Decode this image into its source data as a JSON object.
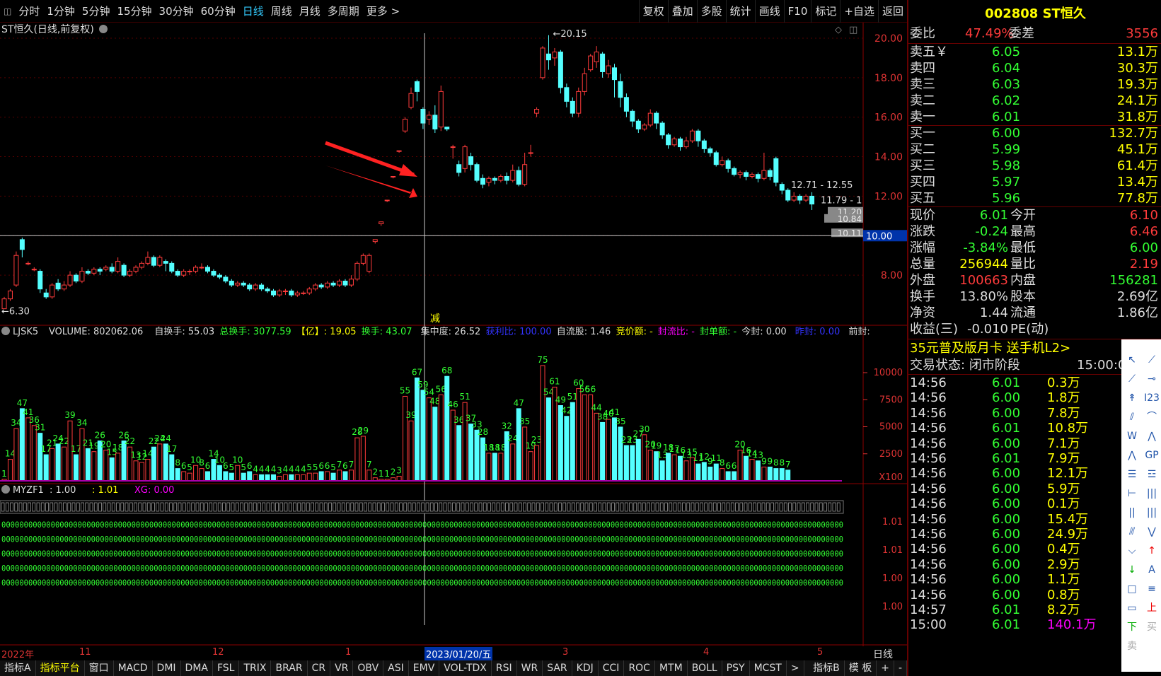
{
  "periods": [
    "分时",
    "1分钟",
    "5分钟",
    "15分钟",
    "30分钟",
    "60分钟",
    "日线",
    "周线",
    "月线",
    "多周期",
    "更多 >"
  ],
  "active_period": "日线",
  "tools": [
    "复权",
    "叠加",
    "多股",
    "统计",
    "画线",
    "F10",
    "标记",
    "+自选",
    "返回"
  ],
  "chart_title": "ST恒久(日线,前复权)",
  "price_axis": [
    "20.00",
    "18.00",
    "16.00",
    "14.00",
    "12.00",
    "10.00",
    "8.00"
  ],
  "price_cross": "10.00",
  "annotations": {
    "high": "20.15",
    "low": "6.30",
    "range1": "12.71 - 12.55",
    "range2": "11.79 - 1",
    "bar1": "11.20",
    "bar2": "10.84",
    "bar3": "10.11",
    "jian": "减"
  },
  "vol_header": [
    {
      "t": "LJSK5",
      "c": "#ddd"
    },
    {
      "t": "VOLUME: 802062.06",
      "c": "#ddd"
    },
    {
      "t": "自换手: 55.03",
      "c": "#ddd"
    },
    {
      "t": "总换手: 3077.59",
      "c": "#3f3"
    },
    {
      "t": "【亿】: 19.05",
      "c": "#ff0"
    },
    {
      "t": "换手: 43.07",
      "c": "#3f3"
    },
    {
      "t": "集中度: 26.52",
      "c": "#ddd"
    },
    {
      "t": "获利比: 100.00",
      "c": "#33f"
    },
    {
      "t": "自流股: 1.46",
      "c": "#ddd"
    },
    {
      "t": "竞价额: -",
      "c": "#ff0"
    },
    {
      "t": "封流比: -",
      "c": "#f0f"
    },
    {
      "t": "封单额: -",
      "c": "#3f3"
    },
    {
      "t": "今封: 0.00",
      "c": "#ddd"
    },
    {
      "t": "昨封: 0.00",
      "c": "#33f"
    },
    {
      "t": "前封:",
      "c": "#ddd"
    }
  ],
  "vol_axis": [
    "10000",
    "7500",
    "5000",
    "2500",
    "X100"
  ],
  "ind_header": [
    {
      "t": "MYZF1",
      "c": "#ddd"
    },
    {
      "t": ": 1.00",
      "c": "#ddd"
    },
    {
      "t": ": 1.01",
      "c": "#ff0"
    },
    {
      "t": "XG: 0.00",
      "c": "#f0f"
    }
  ],
  "ind_axis": [
    "1.01",
    "1.01",
    "1.00",
    "1.00"
  ],
  "bin_rows": [
    "00000000000000000000000000000000000000000000000000000000000000000000000000000000000000000000000000000000000000000000000000000000000000000000000000000000000000000000000000000000000000000000",
    "00000000000000000000000000000000000000000000000000000000000000000000000000000000000000000000000000000000000000000000000000000000000000000000000000000000000000000000000000000000000000000000",
    "00000000000000000000000000000000000000000000000000000000000000000000000000000000000000000000000000000000000000000000000000000000000000000000000000000000000000000000000000000000000000000000",
    "00000000000000000000000000000000000000000000000000000000000000000000000000000000000000000000000000000000000000000000000000000000000000000000000000000000000000000000000000000000000000000000",
    "00000000000000000000000000000000000000000000000000000000000000000000000000000000000000000000000000000000000000000000000000000000000000000000000000000000000000000000000000000000000000000000"
  ],
  "date_axis": [
    "2022年",
    "11",
    "12",
    "1",
    "2023/01/20/五",
    "3",
    "4",
    "5"
  ],
  "bottom_tabs": [
    "指标A",
    "指标平台",
    "窗口",
    "MACD",
    "DMI",
    "DMA",
    "FSL",
    "TRIX",
    "BRAR",
    "CR",
    "VR",
    "OBV",
    "ASI",
    "EMV",
    "VOL-TDX",
    "RSI",
    "WR",
    "SAR",
    "KDJ",
    "CCI",
    "ROC",
    "MTM",
    "BOLL",
    "PSY",
    "MCST",
    ">",
    "指标B",
    "模 板",
    "+",
    "-"
  ],
  "bottom_right": "日线",
  "quote": {
    "code": "002808 ST恒久",
    "weibi_label": "委比",
    "weibi": "47.49%",
    "weicha_label": "委差",
    "weicha": "3556",
    "asks": [
      [
        "卖五￥",
        "6.05",
        "13.1万"
      ],
      [
        "卖四",
        "6.04",
        "30.3万"
      ],
      [
        "卖三",
        "6.03",
        "19.3万"
      ],
      [
        "卖二",
        "6.02",
        "24.1万"
      ],
      [
        "卖一",
        "6.01",
        "31.8万"
      ]
    ],
    "bids": [
      [
        "买一",
        "6.00",
        "132.7万"
      ],
      [
        "买二",
        "5.99",
        "45.1万"
      ],
      [
        "买三",
        "5.98",
        "61.4万"
      ],
      [
        "买四",
        "5.97",
        "13.4万"
      ],
      [
        "买五",
        "5.96",
        "77.8万"
      ]
    ],
    "stats": [
      [
        "现价",
        "6.01",
        "今开",
        "6.10"
      ],
      [
        "涨跌",
        "-0.24",
        "最高",
        "6.46"
      ],
      [
        "涨幅",
        "-3.84%",
        "最低",
        "6.00"
      ],
      [
        "总量",
        "256944",
        "量比",
        "2.19"
      ],
      [
        "外盘",
        "100663",
        "内盘",
        "156281"
      ],
      [
        "换手",
        "13.80%",
        "股本",
        "2.69亿"
      ],
      [
        "净资",
        "1.44",
        "流通",
        "1.86亿"
      ],
      [
        "收益(三)",
        "-0.010",
        "PE(动)",
        ""
      ]
    ],
    "ad": "35元普及版月卡 送手机L2>",
    "status": "交易状态: 闭市阶段",
    "status_time": "15:00:00",
    "ticks": [
      [
        "14:56",
        "6.01",
        "0.3万"
      ],
      [
        "14:56",
        "6.00",
        "1.8万"
      ],
      [
        "14:56",
        "6.00",
        "7.8万"
      ],
      [
        "14:56",
        "6.01",
        "10.8万"
      ],
      [
        "14:56",
        "6.00",
        "7.1万"
      ],
      [
        "14:56",
        "6.01",
        "7.9万"
      ],
      [
        "14:56",
        "6.00",
        "12.1万"
      ],
      [
        "14:56",
        "6.00",
        "5.9万"
      ],
      [
        "14:56",
        "6.00",
        "0.1万"
      ],
      [
        "14:56",
        "6.00",
        "15.4万"
      ],
      [
        "14:56",
        "6.00",
        "24.9万"
      ],
      [
        "14:56",
        "6.00",
        "0.4万"
      ],
      [
        "14:56",
        "6.00",
        "2.9万"
      ],
      [
        "14:56",
        "6.00",
        "1.1万"
      ],
      [
        "14:56",
        "6.00",
        "0.8万"
      ],
      [
        "14:57",
        "6.01",
        "8.2万"
      ],
      [
        "15:00",
        "6.01",
        "140.1万"
      ]
    ]
  },
  "draw_tools": [
    "cursor",
    "line",
    "ray",
    "segment",
    "arrow",
    "i23",
    "parallel",
    "arc",
    "wave",
    "gann",
    "peak",
    "fib",
    "gp",
    "channel",
    "text",
    "hline",
    "vline",
    "bars",
    "bars2",
    "fan",
    "down",
    "arrow-up",
    "arrow-down",
    "text-a",
    "rect",
    "note",
    "ruler",
    "up-label",
    "down-label",
    "buy",
    "sell"
  ],
  "draw_labels": {
    "buy": "买",
    "sell": "卖",
    "up": "上",
    "down": "下"
  },
  "chart_data": {
    "type": "candlestick",
    "title": "ST恒久(日线,前复权)",
    "ylim": [
      6.0,
      20.5
    ],
    "candles": [
      [
        6.3,
        6.8,
        6.3,
        6.9
      ],
      [
        6.8,
        7.2,
        6.7,
        7.3
      ],
      [
        7.5,
        9.0,
        7.4,
        9.2
      ],
      [
        9.8,
        9.3,
        8.9,
        9.9
      ],
      [
        8.6,
        8.6,
        8.5,
        8.7
      ],
      [
        8.3,
        8.3,
        8.2,
        8.4
      ],
      [
        8.2,
        7.3,
        7.1,
        8.3
      ],
      [
        7.1,
        6.9,
        6.8,
        7.3
      ],
      [
        6.9,
        7.5,
        6.8,
        7.6
      ],
      [
        7.6,
        7.3,
        7.2,
        7.8
      ],
      [
        7.3,
        7.5,
        7.2,
        7.7
      ],
      [
        7.5,
        8.0,
        7.4,
        8.2
      ],
      [
        8.0,
        7.7,
        7.6,
        8.1
      ],
      [
        7.7,
        8.2,
        7.6,
        8.4
      ],
      [
        8.2,
        8.1,
        8.0,
        8.3
      ],
      [
        8.1,
        8.3,
        8.0,
        8.4
      ],
      [
        8.3,
        8.2,
        8.0,
        8.4
      ],
      [
        8.3,
        8.4,
        8.2,
        8.5
      ],
      [
        8.4,
        8.2,
        8.1,
        8.6
      ],
      [
        8.2,
        8.7,
        8.1,
        8.9
      ],
      [
        8.5,
        8.0,
        7.9,
        8.6
      ],
      [
        8.0,
        8.2,
        7.9,
        8.3
      ],
      [
        8.2,
        8.4,
        8.1,
        8.5
      ],
      [
        8.4,
        8.6,
        8.3,
        8.7
      ],
      [
        8.6,
        8.9,
        8.5,
        9.2
      ],
      [
        8.9,
        8.5,
        8.4,
        9.0
      ],
      [
        8.5,
        8.9,
        8.4,
        9.0
      ],
      [
        8.7,
        8.6,
        8.2,
        8.8
      ],
      [
        8.6,
        8.2,
        8.1,
        8.7
      ],
      [
        8.2,
        8.0,
        7.9,
        8.3
      ],
      [
        8.0,
        8.2,
        7.9,
        8.3
      ],
      [
        8.2,
        8.2,
        8.0,
        8.3
      ],
      [
        8.2,
        8.4,
        8.1,
        8.5
      ],
      [
        8.4,
        8.4,
        8.3,
        8.6
      ],
      [
        8.4,
        8.2,
        8.1,
        8.5
      ],
      [
        8.2,
        8.0,
        7.9,
        8.3
      ],
      [
        8.0,
        7.9,
        7.8,
        8.1
      ],
      [
        7.9,
        7.7,
        7.6,
        8.0
      ],
      [
        7.7,
        7.5,
        7.4,
        7.8
      ],
      [
        7.5,
        7.6,
        7.4,
        7.7
      ],
      [
        7.6,
        7.5,
        7.4,
        7.7
      ],
      [
        7.5,
        7.3,
        7.2,
        7.6
      ],
      [
        7.3,
        7.5,
        7.2,
        7.6
      ],
      [
        7.5,
        7.3,
        7.2,
        7.6
      ],
      [
        7.3,
        7.2,
        7.1,
        7.4
      ],
      [
        7.2,
        7.0,
        6.9,
        7.3
      ],
      [
        7.0,
        7.2,
        6.9,
        7.3
      ],
      [
        7.2,
        7.2,
        7.0,
        7.3
      ],
      [
        7.2,
        7.0,
        6.9,
        7.3
      ],
      [
        7.0,
        7.1,
        6.9,
        7.2
      ],
      [
        7.1,
        7.1,
        7.0,
        7.2
      ],
      [
        7.1,
        7.3,
        7.0,
        7.4
      ],
      [
        7.3,
        7.5,
        7.2,
        7.6
      ],
      [
        7.5,
        7.4,
        7.3,
        7.6
      ],
      [
        7.4,
        7.6,
        7.3,
        7.7
      ],
      [
        7.6,
        7.5,
        7.4,
        7.7
      ],
      [
        7.5,
        7.7,
        7.4,
        7.8
      ],
      [
        7.7,
        7.5,
        7.4,
        7.8
      ],
      [
        7.5,
        7.8,
        7.4,
        8.0
      ],
      [
        7.8,
        8.6,
        7.7,
        8.7
      ],
      [
        8.6,
        9.0,
        8.5,
        9.1
      ],
      [
        8.2,
        9.0,
        8.1,
        9.1
      ],
      [
        9.7,
        9.8,
        9.6,
        9.8
      ],
      [
        10.6,
        10.7,
        10.5,
        10.7
      ],
      [
        11.8,
        11.8,
        11.7,
        11.8
      ],
      [
        13.0,
        13.0,
        12.9,
        13.0
      ],
      [
        14.3,
        14.3,
        14.2,
        14.3
      ],
      [
        15.3,
        15.9,
        15.2,
        16.0
      ],
      [
        16.5,
        17.2,
        16.4,
        17.5
      ],
      [
        17.8,
        17.3,
        16.8,
        17.9
      ],
      [
        16.4,
        15.7,
        15.4,
        16.5
      ],
      [
        15.9,
        16.1,
        15.6,
        16.3
      ],
      [
        16.1,
        15.4,
        15.2,
        16.6
      ],
      [
        15.5,
        17.3,
        15.3,
        17.6
      ],
      [
        15.5,
        15.4,
        15.3,
        15.5
      ],
      [
        14.5,
        14.5,
        13.9,
        14.6
      ],
      [
        13.6,
        13.2,
        13.0,
        13.8
      ],
      [
        13.4,
        14.5,
        13.2,
        14.6
      ],
      [
        14.0,
        13.6,
        13.3,
        14.2
      ],
      [
        13.6,
        12.8,
        12.7,
        13.7
      ],
      [
        12.9,
        12.6,
        12.4,
        13.1
      ],
      [
        12.7,
        12.9,
        12.5,
        13.0
      ],
      [
        12.9,
        12.8,
        12.6,
        13.0
      ],
      [
        12.8,
        13.0,
        12.7,
        13.1
      ],
      [
        13.0,
        12.8,
        12.6,
        13.2
      ],
      [
        12.8,
        13.3,
        12.7,
        13.6
      ],
      [
        13.3,
        12.6,
        12.5,
        13.5
      ],
      [
        12.6,
        13.6,
        12.5,
        14.2
      ],
      [
        14.2,
        14.2,
        14.0,
        14.6
      ],
      [
        16.2,
        16.4,
        16.0,
        16.5
      ],
      [
        18.0,
        19.5,
        17.9,
        19.6
      ],
      [
        19.2,
        18.9,
        18.4,
        20.15
      ],
      [
        19.0,
        19.3,
        18.6,
        19.5
      ],
      [
        19.3,
        17.5,
        17.2,
        19.4
      ],
      [
        17.5,
        16.8,
        16.5,
        17.7
      ],
      [
        16.8,
        16.2,
        16.0,
        17.0
      ],
      [
        16.2,
        17.3,
        16.0,
        17.5
      ],
      [
        17.3,
        18.2,
        17.1,
        18.5
      ],
      [
        18.4,
        19.1,
        18.3,
        19.2
      ],
      [
        18.8,
        19.3,
        18.5,
        19.6
      ],
      [
        19.2,
        18.3,
        18.0,
        19.3
      ],
      [
        18.2,
        18.6,
        18.0,
        18.9
      ],
      [
        18.5,
        17.9,
        17.0,
        18.7
      ],
      [
        17.8,
        17.0,
        16.5,
        18.2
      ],
      [
        17.0,
        16.3,
        16.0,
        17.2
      ],
      [
        16.3,
        15.8,
        15.5,
        16.4
      ],
      [
        15.8,
        15.4,
        15.2,
        15.9
      ],
      [
        15.4,
        15.6,
        15.3,
        15.7
      ],
      [
        15.6,
        16.2,
        15.5,
        16.4
      ],
      [
        16.2,
        15.7,
        15.4,
        16.3
      ],
      [
        15.7,
        15.1,
        14.9,
        15.8
      ],
      [
        15.1,
        14.6,
        14.4,
        15.2
      ],
      [
        14.6,
        14.9,
        14.5,
        15.0
      ],
      [
        14.9,
        14.5,
        14.3,
        15.0
      ],
      [
        14.5,
        14.8,
        14.4,
        15.0
      ],
      [
        14.8,
        15.3,
        14.7,
        15.4
      ],
      [
        15.3,
        14.8,
        14.5,
        15.4
      ],
      [
        14.8,
        14.4,
        14.2,
        14.9
      ],
      [
        14.4,
        14.2,
        14.0,
        14.5
      ],
      [
        14.2,
        13.6,
        13.5,
        14.3
      ],
      [
        13.6,
        13.8,
        13.5,
        14.0
      ],
      [
        13.8,
        13.4,
        13.2,
        13.9
      ],
      [
        13.4,
        13.1,
        13.0,
        13.5
      ],
      [
        13.1,
        13.2,
        12.9,
        13.3
      ],
      [
        13.2,
        13.0,
        12.8,
        13.3
      ],
      [
        13.0,
        13.1,
        12.9,
        13.2
      ],
      [
        13.1,
        12.9,
        12.7,
        13.2
      ],
      [
        12.9,
        13.3,
        12.8,
        14.2
      ],
      [
        13.3,
        13.0,
        12.8,
        13.4
      ],
      [
        13.9,
        12.7,
        12.5,
        14.0
      ],
      [
        12.6,
        12.3,
        12.1,
        12.7
      ],
      [
        12.3,
        11.8,
        11.7,
        12.4
      ],
      [
        11.8,
        12.0,
        11.7,
        12.2
      ],
      [
        12.0,
        11.8,
        11.6,
        12.1
      ],
      [
        11.8,
        12.0,
        11.7,
        12.1
      ],
      [
        12.0,
        11.6,
        11.3,
        12.2
      ]
    ],
    "volume_labels": [
      1,
      14,
      34,
      47,
      41,
      36,
      31,
      17,
      21,
      24,
      22,
      39,
      17,
      34,
      21,
      19,
      26,
      20,
      15,
      18,
      26,
      22,
      13,
      12,
      14,
      22,
      24,
      24,
      17,
      8,
      6,
      5,
      10,
      8,
      6,
      14,
      10,
      6,
      5,
      10,
      5,
      6,
      4,
      4,
      4,
      4,
      3,
      4,
      4,
      4,
      4,
      5,
      5,
      6,
      6,
      5,
      7,
      6,
      7,
      28,
      29,
      7,
      2,
      1,
      1,
      2,
      3,
      55,
      39,
      67,
      59,
      54,
      48,
      56,
      68,
      46,
      36,
      51,
      37,
      33,
      28,
      18,
      18,
      18,
      32,
      24,
      47,
      35,
      19,
      23,
      75,
      54,
      61,
      49,
      42,
      51,
      60,
      56,
      56,
      44,
      38,
      40,
      41,
      35,
      23,
      23,
      27,
      30,
      20,
      19,
      13,
      18,
      17,
      16,
      13,
      15,
      11,
      12,
      9,
      11,
      8,
      6,
      6,
      20,
      16,
      14,
      13,
      9,
      9,
      8,
      8,
      7
    ]
  }
}
